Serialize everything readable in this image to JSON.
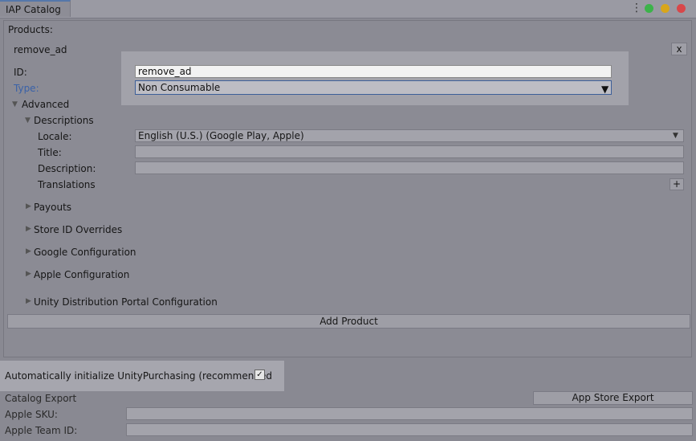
{
  "window": {
    "tab_title": "IAP Catalog",
    "menu_icon": "kebab-menu-icon",
    "controls": {
      "green": "#4caf50",
      "yellow": "#d4a514",
      "red": "#d94a4a"
    }
  },
  "products": {
    "header": "Products:",
    "product_name": "remove_ad",
    "remove_label": "x",
    "id_label": "ID:",
    "id_value": "remove_ad",
    "type_label": "Type:",
    "type_value": "Non Consumable",
    "advanced_label": "Advanced",
    "descriptions": {
      "label": "Descriptions",
      "locale_label": "Locale:",
      "locale_value": "English (U.S.) (Google Play, Apple)",
      "title_label": "Title:",
      "title_value": "",
      "description_label": "Description:",
      "description_value": "",
      "translations_label": "Translations",
      "add_translation_label": "+"
    },
    "sections": {
      "payouts": "Payouts",
      "store_id_overrides": "Store ID Overrides",
      "google_configuration": "Google Configuration",
      "apple_configuration": "Apple Configuration",
      "udp_configuration": "Unity Distribution Portal Configuration"
    },
    "add_product_label": "Add Product"
  },
  "settings": {
    "auto_init_label": "Automatically initialize UnityPurchasing (recommended",
    "auto_init_checked": true,
    "check_mark": "✓"
  },
  "export": {
    "catalog_export_label": "Catalog Export",
    "app_store_export_label": "App Store Export",
    "apple_sku_label": "Apple SKU:",
    "apple_sku_value": "",
    "apple_team_id_label": "Apple Team ID:",
    "apple_team_id_value": ""
  }
}
